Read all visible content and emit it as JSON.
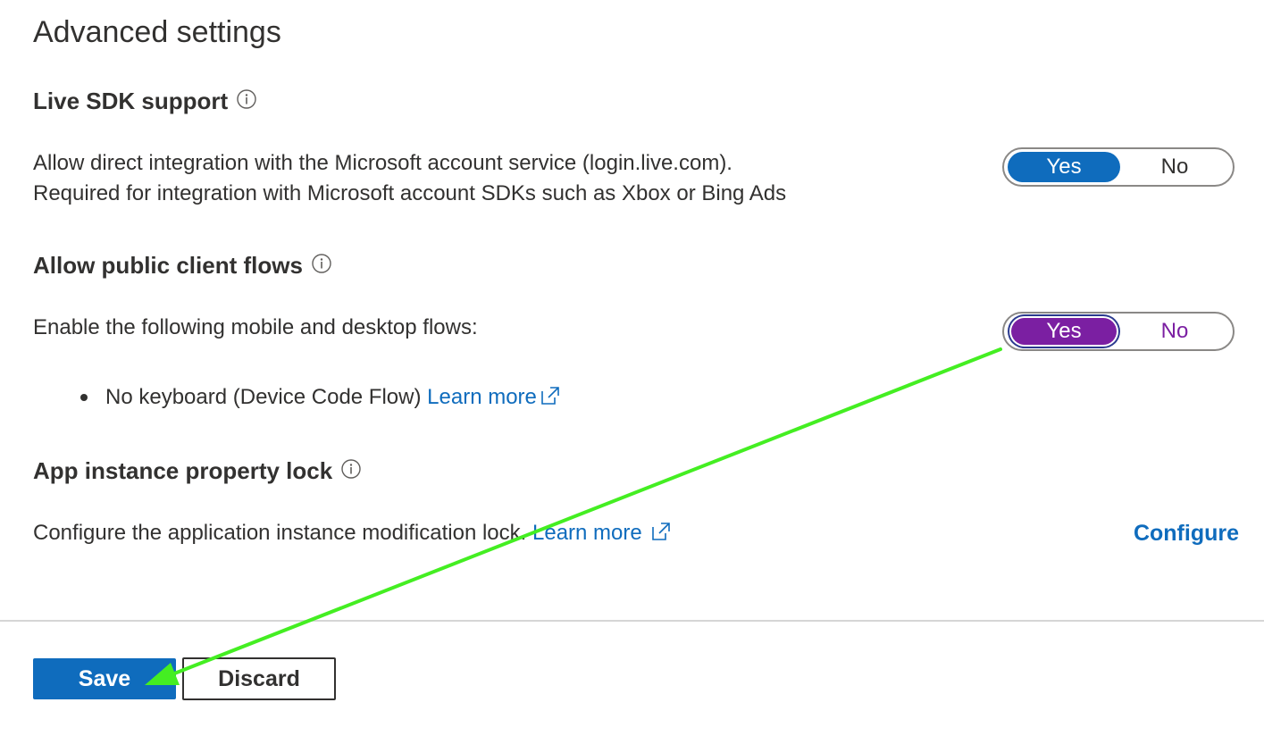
{
  "page": {
    "title": "Advanced settings"
  },
  "live_sdk": {
    "title": "Live SDK support",
    "desc_line1": "Allow direct integration with the Microsoft account service (login.live.com).",
    "desc_line2": "Required for integration with Microsoft account SDKs such as Xbox or Bing Ads",
    "toggle": {
      "yes": "Yes",
      "no": "No",
      "selected": "Yes"
    }
  },
  "public_client": {
    "title": "Allow public client flows",
    "desc": "Enable the following mobile and desktop flows:",
    "toggle": {
      "yes": "Yes",
      "no": "No",
      "selected": "Yes"
    },
    "bullets": [
      {
        "text": "No keyboard (Device Code Flow)",
        "link": "Learn more"
      }
    ]
  },
  "instance_lock": {
    "title": "App instance property lock",
    "desc": "Configure the application instance modification lock.",
    "link": "Learn more",
    "action": "Configure"
  },
  "footer": {
    "save_label": "Save",
    "discard_label": "Discard"
  },
  "colors": {
    "accent_blue": "#0f6cbd",
    "highlight_purple": "#7b1fa2",
    "annotation_green": "#44ee22"
  }
}
